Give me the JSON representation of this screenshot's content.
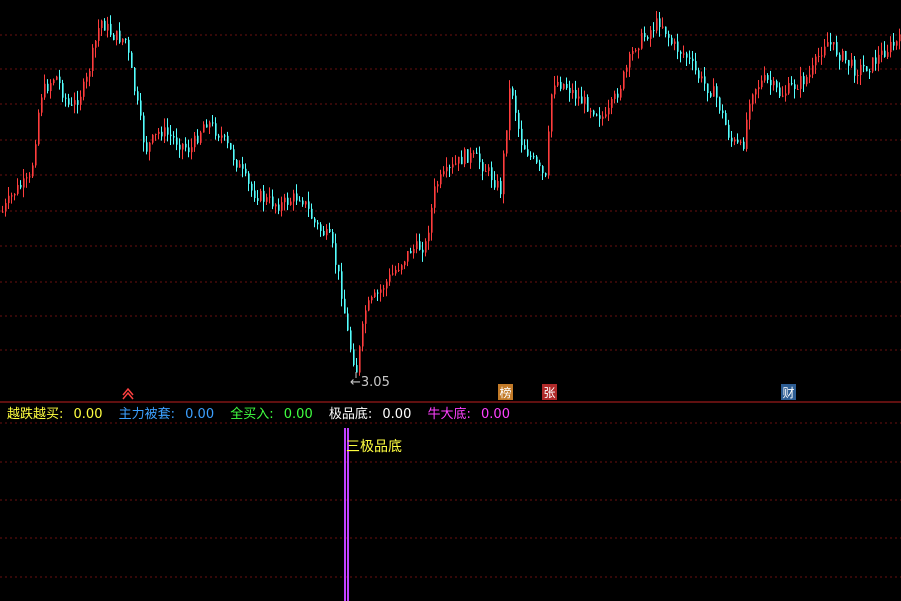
{
  "chart_data": {
    "type": "candlestick",
    "price_panel": {
      "ylim": [
        2.8,
        8.0
      ],
      "grid": true,
      "up_color": "#ff3d3d",
      "down_color": "#54ffff",
      "low_marker": {
        "text": "←3.05",
        "value": 3.05
      },
      "signal_markers": [
        {
          "text": "榜",
          "bg": "#c27a28",
          "fg": "#ffffff"
        },
        {
          "text": "张",
          "bg": "#b02a2a",
          "fg": "#ffffff"
        },
        {
          "text": "财",
          "bg": "#2d5d93",
          "fg": "#ffffff"
        }
      ],
      "arrow_marker": {
        "color": "#ff4040"
      }
    },
    "indicator_panel": {
      "legend": [
        {
          "label": "越跌越买:",
          "value": "0.00",
          "color": "#ffff40"
        },
        {
          "label": "主力被套:",
          "value": "0.00",
          "color": "#3ca0ff"
        },
        {
          "label": "全买入:",
          "value": "0.00",
          "color": "#40ff40"
        },
        {
          "label": "极品底:",
          "value": "0.00",
          "color": "#ffffff"
        },
        {
          "label": "牛大底:",
          "value": "0.00",
          "color": "#ff40ff"
        }
      ],
      "signal_label": {
        "text": "三极品底",
        "color": "#ffff40"
      },
      "signal_bar_color": "#c040ff"
    }
  }
}
